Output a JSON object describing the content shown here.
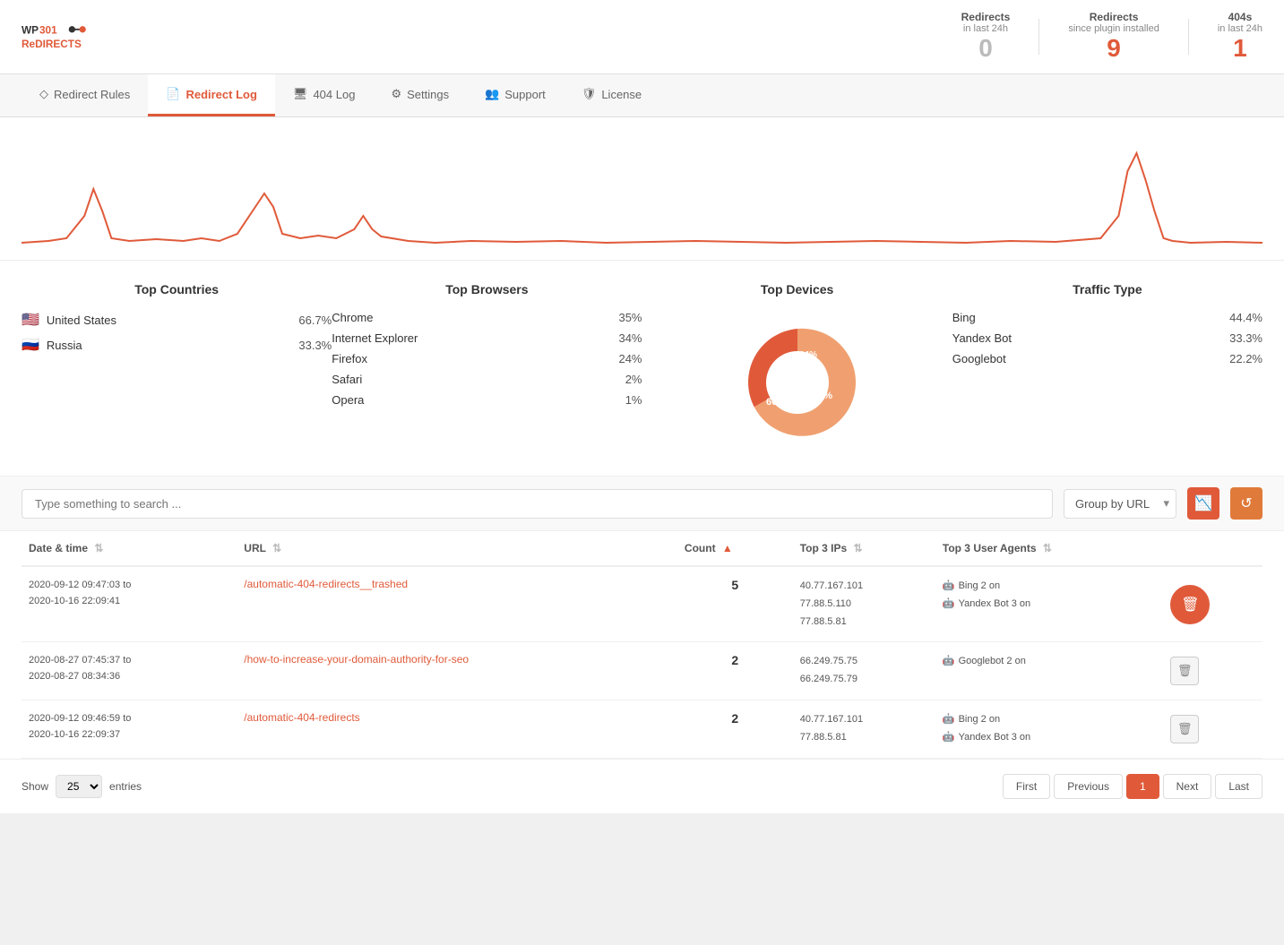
{
  "header": {
    "logo_text": "WP 301 REDIRECTS",
    "stats": [
      {
        "label": "Redirects",
        "sublabel": "in last 24h",
        "value": "0",
        "value_style": "gray"
      },
      {
        "label": "Redirects",
        "sublabel": "since plugin installed",
        "value": "9",
        "value_style": "red"
      },
      {
        "label": "404s",
        "sublabel": "in last 24h",
        "value": "1",
        "value_style": "red"
      }
    ]
  },
  "nav": {
    "tabs": [
      {
        "id": "redirect-rules",
        "label": "Redirect Rules",
        "icon": "diamond"
      },
      {
        "id": "redirect-log",
        "label": "Redirect Log",
        "icon": "document",
        "active": true
      },
      {
        "id": "404-log",
        "label": "404 Log",
        "icon": "server"
      },
      {
        "id": "settings",
        "label": "Settings",
        "icon": "gear"
      },
      {
        "id": "support",
        "label": "Support",
        "icon": "people"
      },
      {
        "id": "license",
        "label": "License",
        "icon": "shield"
      }
    ]
  },
  "top_countries": {
    "title": "Top Countries",
    "items": [
      {
        "flag": "🇺🇸",
        "name": "United States",
        "pct": "66.7%"
      },
      {
        "flag": "🇷🇺",
        "name": "Russia",
        "pct": "33.3%"
      }
    ]
  },
  "top_browsers": {
    "title": "Top Browsers",
    "items": [
      {
        "name": "Chrome",
        "pct": "35%"
      },
      {
        "name": "Internet Explorer",
        "pct": "34%"
      },
      {
        "name": "Firefox",
        "pct": "24%"
      },
      {
        "name": "Safari",
        "pct": "2%"
      },
      {
        "name": "Opera",
        "pct": "1%"
      }
    ]
  },
  "top_devices": {
    "title": "Top Devices",
    "segments": [
      {
        "label": "60%",
        "value": 60,
        "color": "#f0a070"
      },
      {
        "label": "26%",
        "value": 26,
        "color": "#e05a3a"
      },
      {
        "label": "14%",
        "value": 14,
        "color": "#e87a5a"
      }
    ]
  },
  "traffic_type": {
    "title": "Traffic Type",
    "items": [
      {
        "name": "Bing",
        "pct": "44.4%"
      },
      {
        "name": "Yandex Bot",
        "pct": "33.3%"
      },
      {
        "name": "Googlebot",
        "pct": "22.2%"
      }
    ]
  },
  "toolbar": {
    "search_placeholder": "Type something to search ...",
    "group_by_label": "Group by URL",
    "chart_btn_icon": "📈",
    "reset_btn_icon": "🔄"
  },
  "table": {
    "columns": [
      {
        "id": "datetime",
        "label": "Date & time",
        "sortable": true
      },
      {
        "id": "url",
        "label": "URL",
        "sortable": true
      },
      {
        "id": "count",
        "label": "Count",
        "sortable": true,
        "sorted": "asc"
      },
      {
        "id": "top3ips",
        "label": "Top 3 IPs",
        "sortable": true
      },
      {
        "id": "top3agents",
        "label": "Top 3 User Agents",
        "sortable": true
      }
    ],
    "rows": [
      {
        "date_from": "2020-09-12 09:47:03 to",
        "date_to": "2020-10-16 22:09:41",
        "url": "/automatic-404-redirects__trashed",
        "count": "5",
        "ips": [
          "40.77.167.101",
          "77.88.5.110",
          "77.88.5.81"
        ],
        "agents": [
          "Bing 2 on",
          "Yandex Bot 3 on"
        ],
        "delete_highlighted": true
      },
      {
        "date_from": "2020-08-27 07:45:37 to",
        "date_to": "2020-08-27 08:34:36",
        "url": "/how-to-increase-your-domain-authority-for-seo",
        "count": "2",
        "ips": [
          "66.249.75.75",
          "66.249.75.79"
        ],
        "agents": [
          "Googlebot 2 on"
        ],
        "delete_highlighted": false
      },
      {
        "date_from": "2020-09-12 09:46:59 to",
        "date_to": "2020-10-16 22:09:37",
        "url": "/automatic-404-redirects",
        "count": "2",
        "ips": [
          "40.77.167.101",
          "77.88.5.81"
        ],
        "agents": [
          "Bing 2 on",
          "Yandex Bot 3 on"
        ],
        "delete_highlighted": false
      }
    ]
  },
  "pagination": {
    "show_label": "Show",
    "show_value": "25",
    "entries_label": "entries",
    "first_label": "First",
    "previous_label": "Previous",
    "current_page": "1",
    "next_label": "Next",
    "last_label": "Last"
  }
}
